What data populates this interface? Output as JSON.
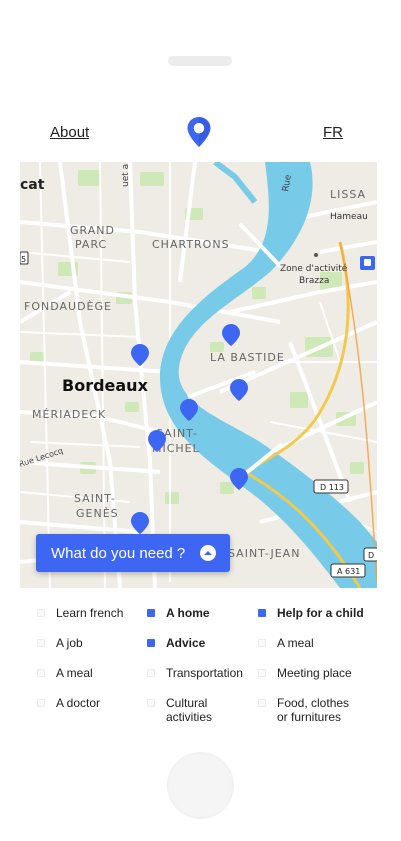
{
  "header": {
    "about_label": "About",
    "lang_label": "FR",
    "logo_icon": "location-pin-icon",
    "accent_color": "#3d66f2"
  },
  "map": {
    "labels": {
      "cat": "cat",
      "grand": "GRAND",
      "parc": "PARC",
      "chartrons": "CHARTRONS",
      "lissa": "LISSA",
      "hameau": "Hameau",
      "zone1": "Zone d'activité",
      "zone2": "Brazza",
      "fondaudege": "FONDAUDÈGE",
      "labastide": "LA BASTIDE",
      "bordeaux": "Bordeaux",
      "meriadeck": "MÉRIADECK",
      "ruelecocq": "Rue Lecocq",
      "saint": "SAINT-",
      "michel": "MICHEL",
      "saint2": "SAINT-",
      "genes": "GENÈS",
      "saintjean": "SAINT-JEAN",
      "d113": "D 113",
      "a631": "A 631",
      "d": "D",
      "rue": "Rue",
      "ueta": "uet a",
      "five": "5"
    },
    "marker_color": "#3d66f2"
  },
  "need_button": {
    "label": "What do you need ?",
    "icon": "chevron-up-icon"
  },
  "options": [
    {
      "label": "Learn french",
      "checked": false
    },
    {
      "label": "A home",
      "checked": true
    },
    {
      "label": "Help for a child",
      "checked": true
    },
    {
      "label": "A job",
      "checked": false
    },
    {
      "label": "Advice",
      "checked": true
    },
    {
      "label": "A meal",
      "checked": false
    },
    {
      "label": "A meal",
      "checked": false
    },
    {
      "label": "Transportation",
      "checked": false
    },
    {
      "label": "Meeting place",
      "checked": false
    },
    {
      "label": "A doctor",
      "checked": false
    },
    {
      "label": "Cultural\nactivities",
      "checked": false
    },
    {
      "label": "Food, clothes\nor furnitures",
      "checked": false
    }
  ]
}
